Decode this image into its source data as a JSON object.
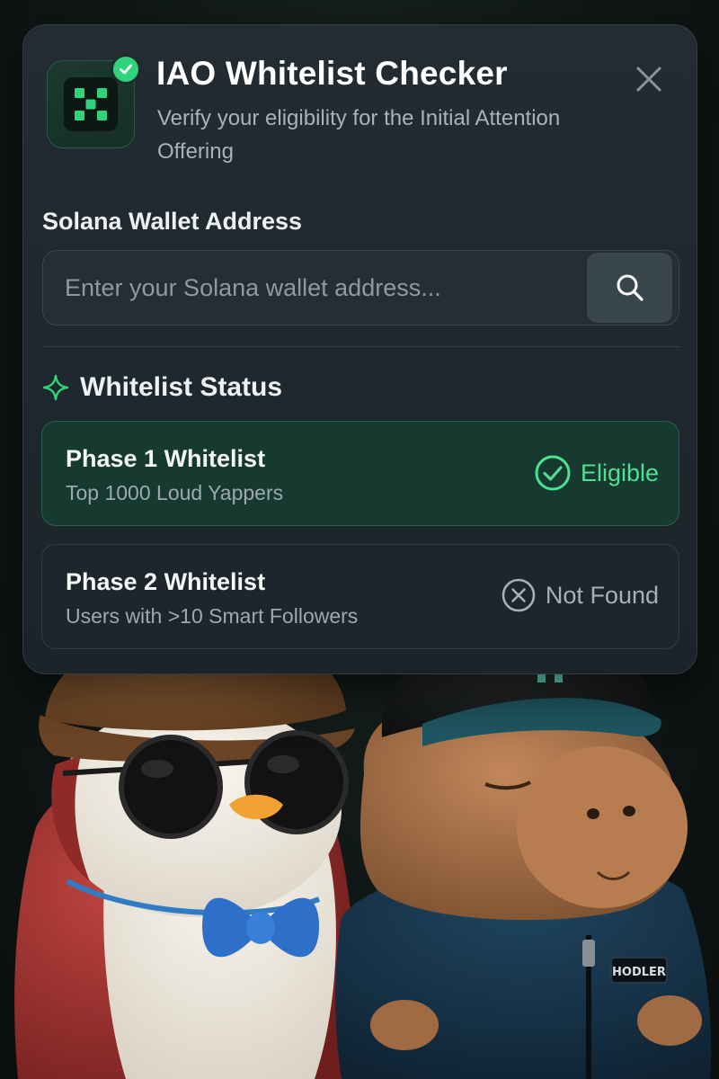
{
  "colors": {
    "accent_green": "#2fd37a",
    "card_bg": "#1f282e",
    "page_bg": "#101716",
    "eligible_bg": "#173a30",
    "muted_text": "#a9b3b7"
  },
  "header": {
    "logo_icon": "x-mark-logo-icon",
    "verified_badge_icon": "check-circle-icon",
    "title": "IAO Whitelist Checker",
    "subtitle": "Verify your eligibility for the Initial Attention Offering",
    "close_icon": "close-icon"
  },
  "wallet": {
    "label": "Solana Wallet Address",
    "value": "",
    "placeholder": "Enter your Solana wallet address...",
    "search_icon": "search-icon"
  },
  "status_section": {
    "icon": "sparkle-icon",
    "title": "Whitelist Status",
    "phases": [
      {
        "name": "Phase 1 Whitelist",
        "description": "Top 1000 Loud Yappers",
        "status": "Eligible",
        "status_icon": "check-circle-icon",
        "status_color": "#4fe08f"
      },
      {
        "name": "Phase 2 Whitelist",
        "description": "Users with >10 Smart Followers",
        "status": "Not Found",
        "status_icon": "x-circle-icon",
        "status_color": "#a7b0b4"
      }
    ]
  },
  "illustration": {
    "left_character": "penguin-with-flat-cap-sunglasses-bowtie",
    "right_character": "capybara-with-cap-and-jacket",
    "jacket_patch_text": "HODLER"
  }
}
